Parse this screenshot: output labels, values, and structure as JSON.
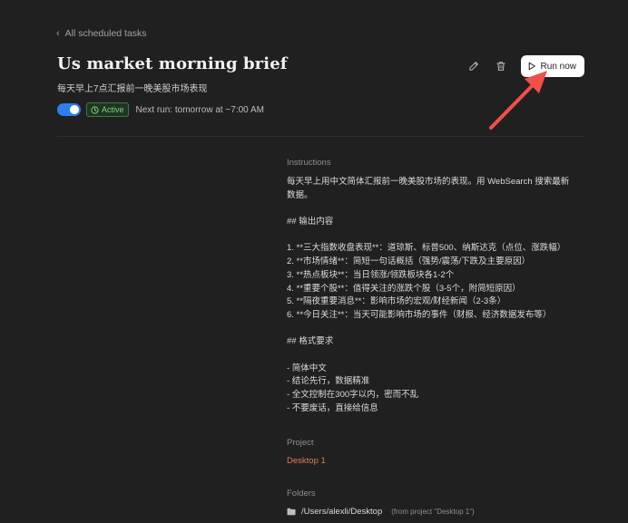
{
  "nav": {
    "back_label": "All scheduled tasks"
  },
  "task": {
    "title": "Us market morning brief",
    "subtitle": "每天早上7点汇报前一晚美股市场表现",
    "status_label": "Active",
    "next_run": "Next run: tomorrow at ~7:00 AM",
    "enabled": true
  },
  "actions": {
    "run_label": "Run now"
  },
  "instructions": {
    "label": "Instructions",
    "lines": [
      "每天早上用中文简体汇报前一晚美股市场的表现。用 WebSearch 搜索最新",
      "数据。",
      "",
      "## 输出内容",
      "",
      "1. **三大指数收盘表现**：道琼斯、标普500、纳斯达克（点位、涨跌幅）",
      "2. **市场情绪**：简短一句话概括（强势/震荡/下跌及主要原因）",
      "3. **热点板块**：当日领涨/领跌板块各1-2个",
      "4. **重要个股**：值得关注的涨跌个股（3-5个，附简短原因）",
      "5. **隔夜重要消息**：影响市场的宏观/财经新闻（2-3条）",
      "6. **今日关注**：当天可能影响市场的事件（财报、经济数据发布等）",
      "",
      "## 格式要求",
      "",
      "- 简体中文",
      "- 结论先行，数据精准",
      "- 全文控制在300字以内，密而不乱",
      "- 不要废话，直接给信息"
    ]
  },
  "project": {
    "label": "Project",
    "name": "Desktop 1"
  },
  "folders": {
    "label": "Folders",
    "path": "/Users/alexli/Desktop",
    "note": "(from project \"Desktop 1\")"
  },
  "colors": {
    "background": "#202020",
    "toggle_on": "#2f7de9",
    "active_badge": "#7fd27f",
    "project_link": "#e37a5a",
    "annotation_arrow": "#f0504a"
  }
}
